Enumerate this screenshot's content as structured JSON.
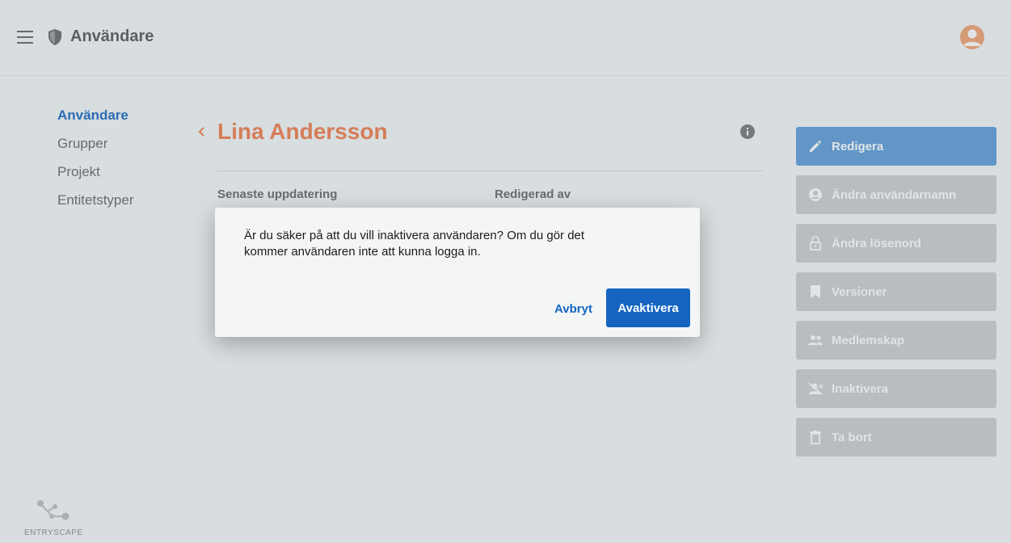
{
  "header": {
    "title": "Användare",
    "menu_icon": "hamburger-menu-icon",
    "app_icon": "shield-icon",
    "avatar_icon": "account-circle-icon",
    "avatar_color": "#f0a070"
  },
  "sidebar": {
    "items": [
      {
        "label": "Användare",
        "active": true
      },
      {
        "label": "Grupper",
        "active": false
      },
      {
        "label": "Projekt",
        "active": false
      },
      {
        "label": "Entitetstyper",
        "active": false
      }
    ]
  },
  "main": {
    "entity_name": "Lina Andersson",
    "meta": {
      "last_updated_label": "Senaste uppdatering",
      "edited_by_label": "Redigerad av"
    }
  },
  "actions": [
    {
      "label": "Redigera",
      "icon": "pencil-icon"
    },
    {
      "label": "Ändra användarnamn",
      "icon": "account-circle-icon"
    },
    {
      "label": "Ändra lösenord",
      "icon": "lock-icon"
    },
    {
      "label": "Versioner",
      "icon": "bookmark-icon"
    },
    {
      "label": "Medlemskap",
      "icon": "people-icon"
    },
    {
      "label": "Inaktivera",
      "icon": "person-off-icon"
    },
    {
      "label": "Ta bort",
      "icon": "trash-icon"
    }
  ],
  "footer": {
    "logo_text": "ENTRYSCAPE"
  },
  "dialog": {
    "message": "Är du säker på att du vill inaktivera användaren? Om du gör det kommer användaren inte att kunna logga in.",
    "cancel_label": "Avbryt",
    "confirm_label": "Avaktivera"
  },
  "colors": {
    "accent": "#1565c0",
    "name_accent": "#f07c4a",
    "action_button": "#c9cdcf"
  }
}
